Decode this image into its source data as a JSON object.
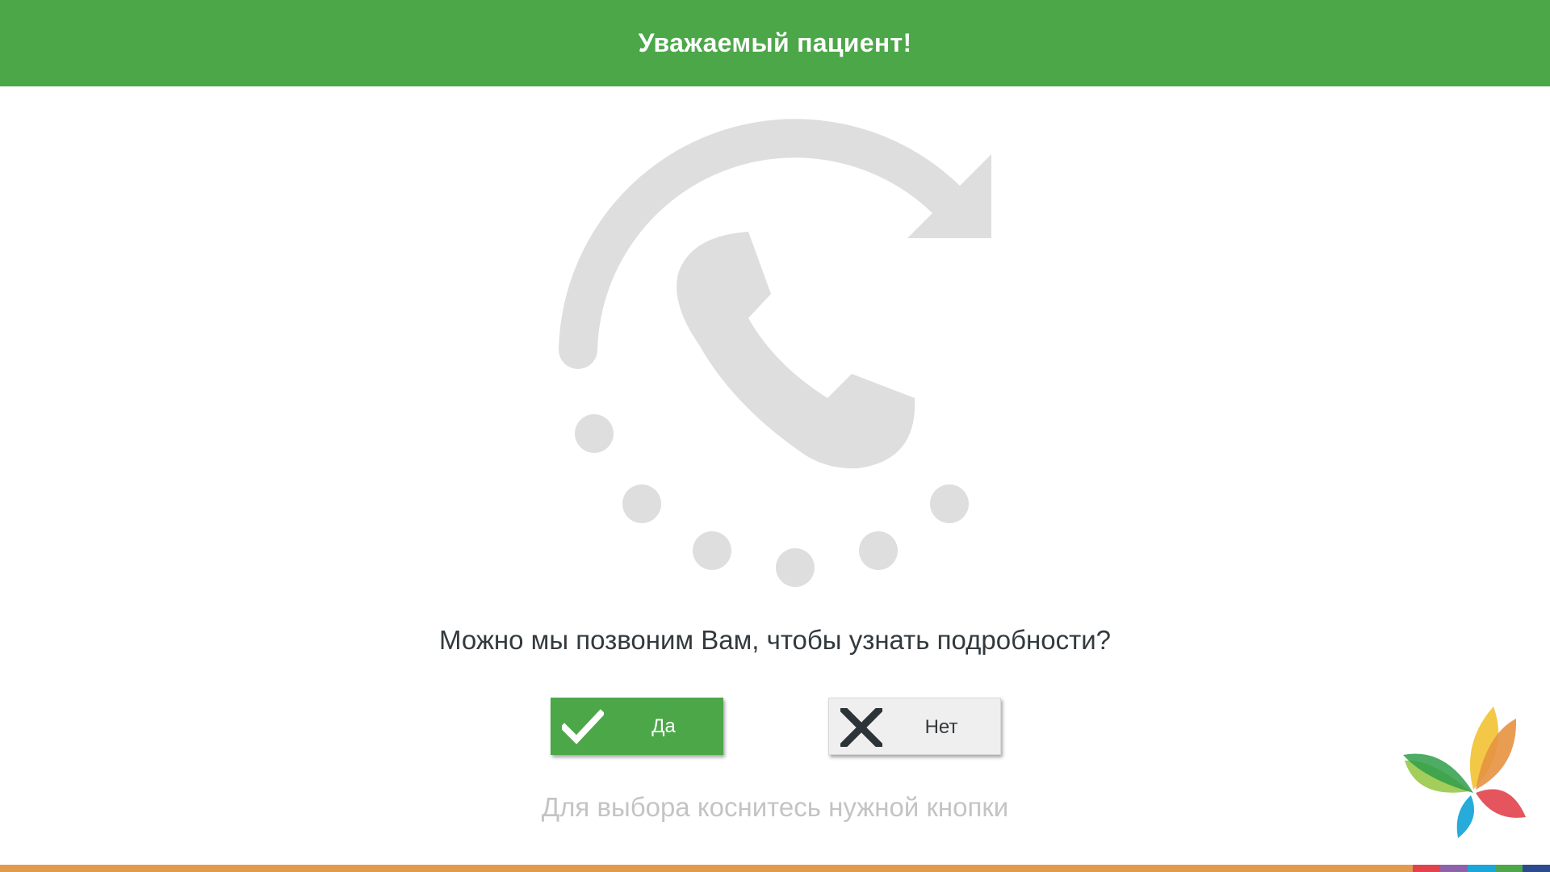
{
  "header": {
    "title": "Уважаемый пациент!"
  },
  "hero": {
    "icon": "phone-callback-icon",
    "color": "#dedede"
  },
  "question": {
    "text": "Можно мы позвоним Вам, чтобы узнать подробности?"
  },
  "buttons": {
    "yes": {
      "label": "Да",
      "icon": "checkmark-icon",
      "color": "#4ba748"
    },
    "no": {
      "label": "Нет",
      "icon": "cross-icon",
      "color": "#efefef"
    }
  },
  "hint": {
    "text": "Для выбора коснитесь нужной кнопки"
  },
  "colors": {
    "accent": "#4ba748",
    "bottom_bar": "#e39a4b",
    "bottom_segments": [
      "#e2424b",
      "#8e62a8",
      "#1aa6d9",
      "#4ba748",
      "#2b4b8e"
    ]
  }
}
